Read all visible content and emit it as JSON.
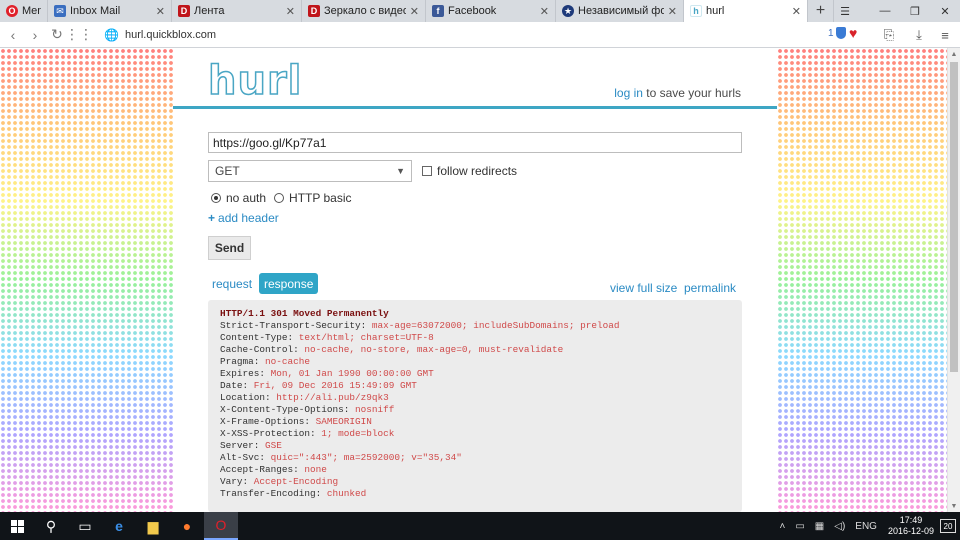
{
  "browser": {
    "menu_label": "Menu",
    "tabs": [
      {
        "title": "Inbox Mail",
        "icon": "mail-icon",
        "color": "#3a6ec0"
      },
      {
        "title": "Лента",
        "icon": "d-logo-icon",
        "color": "#c0151b"
      },
      {
        "title": "Зеркало с видео регис",
        "icon": "d-logo-icon",
        "color": "#c0151b"
      },
      {
        "title": "Facebook",
        "icon": "facebook-icon",
        "color": "#3b5998"
      },
      {
        "title": "Независимый форум п",
        "icon": "forum-icon",
        "color": "#1e3a7a"
      },
      {
        "title": "hurl",
        "icon": "hurl-icon",
        "color": "#4aa6c4"
      }
    ],
    "url": "hurl.quickblox.com",
    "shield_count": "1"
  },
  "header": {
    "logo_text": "hurl",
    "login_link": "log in",
    "login_suffix": " to save your hurls"
  },
  "form": {
    "url_value": "https://goo.gl/Kp77a1",
    "method": "GET",
    "follow_redirects_label": "follow redirects",
    "auth_options": [
      "no auth",
      "HTTP basic"
    ],
    "add_header": "add header",
    "send_label": "Send"
  },
  "response_tabs": {
    "request": "request",
    "response": "response",
    "view_full_size": "view full size",
    "permalink": "permalink"
  },
  "response": {
    "status": "HTTP/1.1 301 Moved Permanently",
    "headers": [
      {
        "name": "Strict-Transport-Security:",
        "value": "max-age=63072000; includeSubDomains; preload"
      },
      {
        "name": "Content-Type:",
        "value": "text/html; charset=UTF-8"
      },
      {
        "name": "Cache-Control:",
        "value": "no-cache, no-store, max-age=0, must-revalidate"
      },
      {
        "name": "Pragma:",
        "value": "no-cache"
      },
      {
        "name": "Expires:",
        "value": "Mon, 01 Jan 1990 00:00:00 GMT"
      },
      {
        "name": "Date:",
        "value": "Fri, 09 Dec 2016 15:49:09 GMT"
      },
      {
        "name": "Location:",
        "value": "http://ali.pub/z9qk3"
      },
      {
        "name": "X-Content-Type-Options:",
        "value": "nosniff"
      },
      {
        "name": "X-Frame-Options:",
        "value": "SAMEORIGIN"
      },
      {
        "name": "X-XSS-Protection:",
        "value": "1; mode=block"
      },
      {
        "name": "Server:",
        "value": "GSE"
      },
      {
        "name": "Alt-Svc:",
        "value": "quic=\":443\"; ma=2592000; v=\"35,34\""
      },
      {
        "name": "Accept-Ranges:",
        "value": "none"
      },
      {
        "name": "Vary:",
        "value": "Accept-Encoding"
      },
      {
        "name": "Transfer-Encoding:",
        "value": "chunked"
      }
    ]
  },
  "taskbar": {
    "language": "ENG",
    "time": "17:49",
    "date": "2016-12-09",
    "notifications": "20"
  }
}
